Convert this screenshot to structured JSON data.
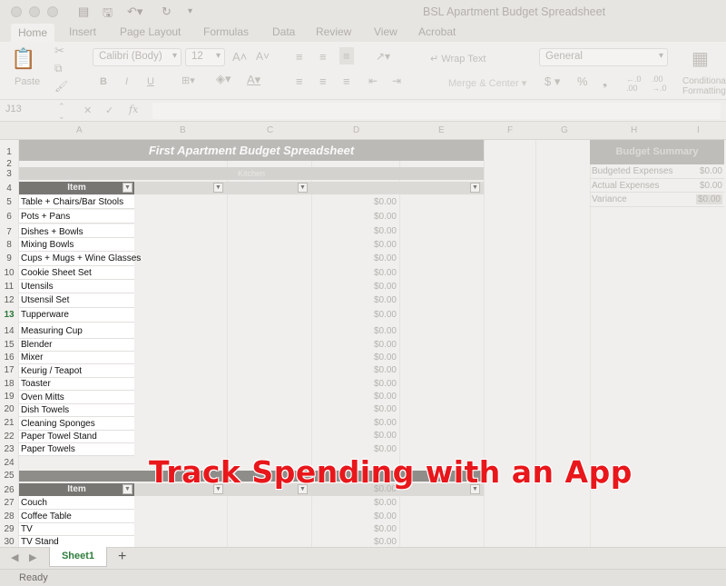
{
  "window": {
    "title": "BSL Apartment Budget Spreadsheet"
  },
  "ribbon_tabs": [
    "Home",
    "Insert",
    "Page Layout",
    "Formulas",
    "Data",
    "Review",
    "View",
    "Acrobat"
  ],
  "ribbon": {
    "paste_label": "Paste",
    "font_name": "Calibri (Body)",
    "font_size": "12",
    "wrap_text": "Wrap Text",
    "merge_center": "Merge & Center",
    "number_format": "General",
    "conditional_formatting": "Conditional Formatting"
  },
  "formula_bar": {
    "name_box": "J13",
    "fx": "fx"
  },
  "columns": [
    "A",
    "B",
    "C",
    "D",
    "E",
    "F",
    "G",
    "H",
    "I"
  ],
  "sheet": {
    "title": "First Apartment Budget Spreadsheet",
    "kitchen_header": "Kitchen",
    "item_header": "Item",
    "kitchen_items": [
      {
        "row": "5",
        "item": "Table + Chairs/Bar Stools",
        "amount": "$0.00"
      },
      {
        "row": "6",
        "item": "Pots + Pans",
        "amount": "$0.00"
      },
      {
        "row": "7",
        "item": "Dishes + Bowls",
        "amount": "$0.00"
      },
      {
        "row": "8",
        "item": "Mixing Bowls",
        "amount": "$0.00"
      },
      {
        "row": "9",
        "item": "Cups + Mugs + Wine Glasses",
        "amount": "$0.00"
      },
      {
        "row": "10",
        "item": "Cookie Sheet Set",
        "amount": "$0.00"
      },
      {
        "row": "11",
        "item": "Utensils",
        "amount": "$0.00"
      },
      {
        "row": "12",
        "item": "Utsensil Set",
        "amount": "$0.00"
      },
      {
        "row": "13",
        "item": "Tupperware",
        "amount": "$0.00"
      },
      {
        "row": "14",
        "item": "Measuring Cup",
        "amount": "$0.00"
      },
      {
        "row": "15",
        "item": "Blender",
        "amount": "$0.00"
      },
      {
        "row": "16",
        "item": "Mixer",
        "amount": "$0.00"
      },
      {
        "row": "17",
        "item": "Keurig / Teapot",
        "amount": "$0.00"
      },
      {
        "row": "18",
        "item": "Toaster",
        "amount": "$0.00"
      },
      {
        "row": "19",
        "item": "Oven Mitts",
        "amount": "$0.00"
      },
      {
        "row": "20",
        "item": "Dish Towels",
        "amount": "$0.00"
      },
      {
        "row": "21",
        "item": "Cleaning Sponges",
        "amount": "$0.00"
      },
      {
        "row": "22",
        "item": "Paper Towel Stand",
        "amount": "$0.00"
      },
      {
        "row": "23",
        "item": "Paper Towels",
        "amount": "$0.00"
      }
    ],
    "living_items": [
      {
        "row": "27",
        "item": "Couch",
        "amount": "$0.00"
      },
      {
        "row": "28",
        "item": "Coffee Table",
        "amount": "$0.00"
      },
      {
        "row": "29",
        "item": "TV",
        "amount": "$0.00"
      },
      {
        "row": "30",
        "item": "TV Stand",
        "amount": "$0.00"
      }
    ],
    "section2_item_header": "Item",
    "section2_amount": "$0.00",
    "extra_rows": [
      "1",
      "2",
      "3",
      "4",
      "24",
      "25",
      "26"
    ],
    "selected_row": "13"
  },
  "budget_summary": {
    "title": "Budget Summary",
    "rows": [
      {
        "label": "Budgeted Expenses",
        "value": "$0.00"
      },
      {
        "label": "Actual Expenses",
        "value": "$0.00"
      },
      {
        "label": "Variance",
        "value": "$0.00"
      }
    ]
  },
  "sheet_tabs": {
    "active": "Sheet1",
    "add": "+"
  },
  "status": {
    "text": "Ready"
  },
  "overlay": {
    "headline": "Track Spending with an App"
  }
}
